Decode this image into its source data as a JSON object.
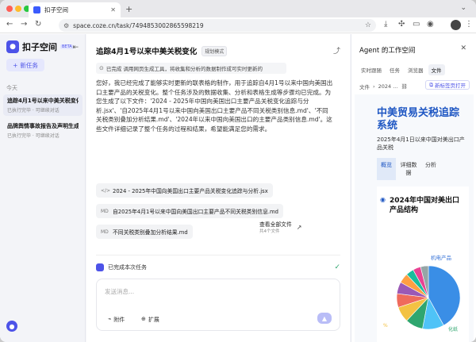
{
  "browser": {
    "tab_title": "扣子空间",
    "url": "space.coze.cn/task/7494853002865598219"
  },
  "sidebar": {
    "brand": "扣子空间",
    "beta": "BETA",
    "new_task": "新任务",
    "section": "今天",
    "tasks": [
      {
        "title": "追踪4月1号以来中美关税变化",
        "sub": "已执行完毕 · 可继续对话"
      },
      {
        "title": "品牌舆情事故报告及声明生成",
        "sub": "已执行完毕 · 可继续对话"
      }
    ]
  },
  "main": {
    "title": "追踪4月1号以来中美关税变化",
    "mode": "规划模式",
    "status": "已完成 调用网页生成工具，将收集和分析的数据制作成可实时更新的",
    "message": "您好，我已经完成了能够实时更新的联表格的制作，用于追踪自4月1号以来中国向美国出口主要产品的关税变化。整个任务涉及的数据收集、分析和表格生成等步骤均已完成。为您生成了以下文件：'2024 - 2025年中国向美国出口主要产品关税变化追踪与分析.jsx'、'自2025年4月1号以来中国向美国出口主要产品不同关税类别信息.md'、'不同关税类别叠加分析结果.md'、'2024年以来中国向美国出口的主要产品类别信息.md'。这些文件详细记录了整个任务的过程和结果，希望能满足您的需求。",
    "files": [
      {
        "icon": "</>",
        "name": "2024 - 2025年中国向美国出口主要产品关税变化追踪与分析.jsx"
      },
      {
        "icon": "MD",
        "name": "自2025年4月1号以来中国向美国出口主要产品不同关税类别信息.md"
      },
      {
        "icon": "MD",
        "name": "不同关税类别叠加分析结果.md"
      },
      {
        "icon": "MD",
        "name": "2024年以来中国向美国出口的主要产品类别信息.md"
      }
    ],
    "view_all": "查看全部文件",
    "file_count": "共4个文件",
    "done": "已完成本次任务",
    "placeholder": "发送消息...",
    "attach": "附件",
    "expand": "扩展"
  },
  "workspace": {
    "title": "Agent 的工作空间",
    "tabs": [
      "实时跟随",
      "任务",
      "浏览器",
      "文件"
    ],
    "active_tab": "文件",
    "crumbs": [
      "文件",
      "2024 ..."
    ],
    "open_new": "新标签页打开",
    "preview": {
      "title": "中美贸易关税追踪系统",
      "subtitle": "2025年4月1日以来中国对美出口产品关税",
      "tabs": [
        {
          "label": "概览",
          "active": true
        },
        {
          "label": "详细数据",
          "active": false
        },
        {
          "label": "分析",
          "active": false
        }
      ],
      "chart_title": "2024年中国对美出口产品结构",
      "legend": "机电产品",
      "pct_label": "%",
      "slice_label": "化纸"
    }
  },
  "chart_data": {
    "type": "pie",
    "title": "2024年中国对美出口产品结构",
    "legend": [
      "机电产品"
    ],
    "values": [
      42,
      11,
      9,
      8,
      7,
      6,
      5,
      4,
      4,
      4
    ],
    "colors": [
      "#3a8ee6",
      "#4fc3f7",
      "#2fa66f",
      "#f3c243",
      "#ef6b5c",
      "#9b59b6",
      "#ff9f43",
      "#1abc9c",
      "#e84393",
      "#95a5a6"
    ]
  }
}
